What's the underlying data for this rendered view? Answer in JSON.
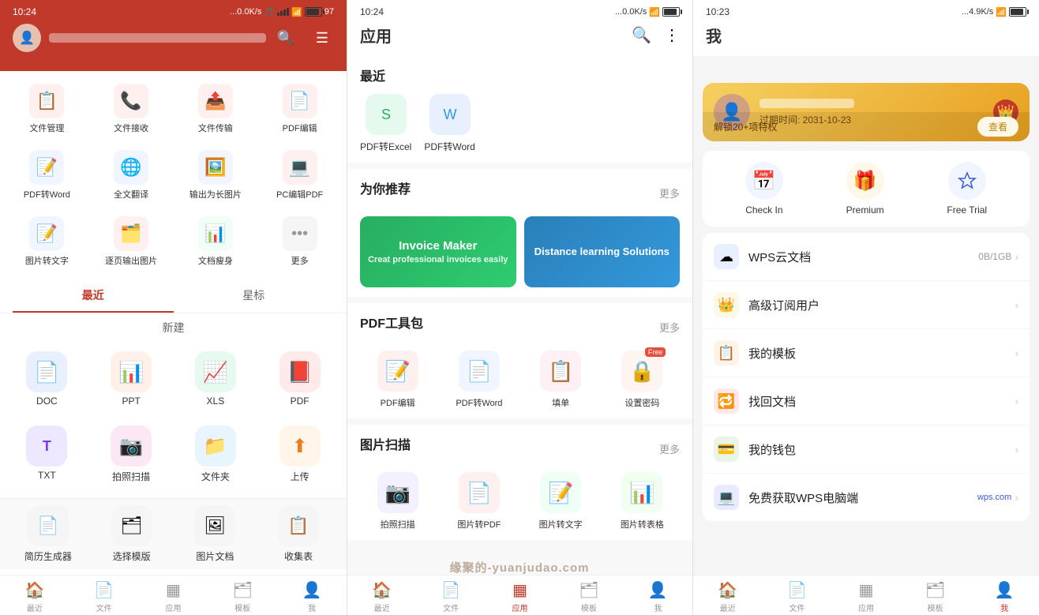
{
  "panel1": {
    "statusBar": {
      "time": "10:24",
      "network": "...0.0K/s",
      "battery": "97"
    },
    "topBar": {
      "searchIcon": "🔍",
      "menuIcon": "☰"
    },
    "tools": [
      {
        "label": "文件管理",
        "icon": "📋",
        "bg": "#fff0f0",
        "color": "#e74c3c"
      },
      {
        "label": "文件接收",
        "icon": "📞",
        "bg": "#fff0f0",
        "color": "#e74c3c"
      },
      {
        "label": "文件传输",
        "icon": "📤",
        "bg": "#fff0f0",
        "color": "#e74c3c"
      },
      {
        "label": "PDF编辑",
        "icon": "📄",
        "bg": "#fff0f0",
        "color": "#e74c3c"
      },
      {
        "label": "PDF转Word",
        "icon": "📝",
        "bg": "#f0f5ff",
        "color": "#3498db"
      },
      {
        "label": "全文翻译",
        "icon": "🌐",
        "bg": "#f0f5ff",
        "color": "#3498db"
      },
      {
        "label": "输出为长图片",
        "icon": "🖼️",
        "bg": "#f0f5ff",
        "color": "#3498db"
      },
      {
        "label": "PC编辑PDF",
        "icon": "💻",
        "bg": "#fff0f0",
        "color": "#e74c3c"
      },
      {
        "label": "图片转文字",
        "icon": "📝",
        "bg": "#f0f5ff",
        "color": "#3498db"
      },
      {
        "label": "逐页输出图片",
        "icon": "🗂️",
        "bg": "#fff0f0",
        "color": "#e74c3c"
      },
      {
        "label": "文档瘦身",
        "icon": "📊",
        "bg": "#f0fff5",
        "color": "#27ae60"
      },
      {
        "label": "更多",
        "icon": "⋯",
        "bg": "#f5f5f5",
        "color": "#999"
      }
    ],
    "tabs": [
      {
        "label": "最近",
        "active": true
      },
      {
        "label": "星标",
        "active": false
      }
    ],
    "newSection": "新建",
    "createItems": [
      {
        "label": "DOC",
        "icon": "📄",
        "bg": "#e8f0fe",
        "color": "#3b5bdb"
      },
      {
        "label": "PPT",
        "icon": "📊",
        "bg": "#fff0ea",
        "color": "#e74c3c"
      },
      {
        "label": "XLS",
        "icon": "📈",
        "bg": "#e6faf0",
        "color": "#27ae60"
      },
      {
        "label": "PDF",
        "icon": "📕",
        "bg": "#ffeaea",
        "color": "#e74c3c"
      }
    ],
    "extraItems": [
      {
        "label": "TXT",
        "icon": "T",
        "bg": "#ede8ff",
        "color": "#7c3aed"
      },
      {
        "label": "拍照扫描",
        "icon": "📷",
        "bg": "#fce8f5",
        "color": "#c0392b"
      },
      {
        "label": "文件夹",
        "icon": "📁",
        "bg": "#e8f5ff",
        "color": "#3498db"
      },
      {
        "label": "上传",
        "icon": "⬆",
        "bg": "#fff5e8",
        "color": "#e67e22"
      }
    ],
    "bottomBar": [
      {
        "label": "最近",
        "icon": "🏠",
        "active": false
      },
      {
        "label": "文件",
        "icon": "📄",
        "active": false
      },
      {
        "label": "应用",
        "icon": "▦",
        "active": false
      },
      {
        "label": "模板",
        "icon": "🗂",
        "active": false
      },
      {
        "label": "我",
        "icon": "👤",
        "active": false
      }
    ],
    "bottomTools": [
      {
        "label": "简历生成器",
        "icon": "📄"
      },
      {
        "label": "选择模版",
        "icon": "🗂"
      },
      {
        "label": "图片文档",
        "icon": "🖼"
      },
      {
        "label": "收集表",
        "icon": "📋"
      }
    ]
  },
  "panel2": {
    "statusBar": {
      "time": "10:24",
      "network": "...0.0K/s"
    },
    "title": "应用",
    "sections": {
      "recent": {
        "title": "最近",
        "items": [
          {
            "label": "PDF转Excel",
            "icon": "📊",
            "bg": "#e6f9ee"
          },
          {
            "label": "PDF转Word",
            "icon": "📝",
            "bg": "#e8f0fe"
          }
        ]
      },
      "recommended": {
        "title": "为你推荐",
        "more": "更多",
        "banners": [
          {
            "title": "Invoice Maker",
            "subtitle": "Creat professional invoices easily",
            "bg": "green"
          },
          {
            "title": "Distance learning Solutions",
            "bg": "blue"
          }
        ]
      },
      "pdfTools": {
        "title": "PDF工具包",
        "more": "更多",
        "items": [
          {
            "label": "PDF编辑",
            "icon": "📝",
            "bg": "#fff0f0",
            "free": false
          },
          {
            "label": "PDF转Word",
            "icon": "📄",
            "bg": "#f0f5ff",
            "free": false
          },
          {
            "label": "填单",
            "icon": "📋",
            "bg": "#fff0f5",
            "free": false
          },
          {
            "label": "设置密码",
            "icon": "🔒",
            "bg": "#fff5f0",
            "free": true
          }
        ]
      },
      "imageScan": {
        "title": "图片扫描",
        "more": "更多",
        "items": [
          {
            "label": "拍照扫描",
            "icon": "📷",
            "bg": "#f5f0ff"
          },
          {
            "label": "图片转PDF",
            "icon": "📄",
            "bg": "#fff0f0"
          },
          {
            "label": "图片转文字",
            "icon": "📝",
            "bg": "#f0fff0"
          },
          {
            "label": "图片转表格",
            "icon": "📊",
            "bg": "#e6f9f0"
          }
        ]
      }
    },
    "bottomBar": [
      {
        "label": "最近",
        "icon": "🏠",
        "active": false
      },
      {
        "label": "文件",
        "icon": "📄",
        "active": false
      },
      {
        "label": "应用",
        "icon": "▦",
        "active": true
      },
      {
        "label": "模板",
        "icon": "🗂",
        "active": false
      },
      {
        "label": "我",
        "icon": "👤",
        "active": false
      }
    ]
  },
  "panel3": {
    "statusBar": {
      "time": "10:23",
      "network": "...4.9K/s"
    },
    "title": "我",
    "vipCard": {
      "expiryLabel": "过期时间: 2031-10-23",
      "unlockText": "解锁20+项特权",
      "viewBtn": "查看"
    },
    "quickActions": [
      {
        "label": "Check In",
        "icon": "📅"
      },
      {
        "label": "Premium",
        "icon": "🎁"
      },
      {
        "label": "Free Trial",
        "icon": "◇"
      }
    ],
    "menuItems": [
      {
        "label": "WPS云文档",
        "icon": "☁",
        "iconBg": "#e8f0ff",
        "iconColor": "#3498db",
        "right": "0B/1GB"
      },
      {
        "label": "高级订阅用户",
        "icon": "👑",
        "iconBg": "#fff8e8",
        "iconColor": "#e8a020",
        "right": ""
      },
      {
        "label": "我的模板",
        "icon": "📋",
        "iconBg": "#fff3e8",
        "iconColor": "#e67e22",
        "right": ""
      },
      {
        "label": "找回文档",
        "icon": "🔁",
        "iconBg": "#ffe8e8",
        "iconColor": "#e74c3c",
        "right": ""
      },
      {
        "label": "我的钱包",
        "icon": "💳",
        "iconBg": "#e8f5e8",
        "iconColor": "#27ae60",
        "right": ""
      },
      {
        "label": "免费获取WPS电脑端",
        "icon": "💻",
        "iconBg": "#eaeaff",
        "iconColor": "#3b5bdb",
        "right": "wps.com"
      }
    ],
    "bottomBar": [
      {
        "label": "最近",
        "icon": "🏠",
        "active": false
      },
      {
        "label": "文件",
        "icon": "📄",
        "active": false
      },
      {
        "label": "应用",
        "icon": "▦",
        "active": false
      },
      {
        "label": "模板",
        "icon": "🗂",
        "active": false
      },
      {
        "label": "我",
        "icon": "👤",
        "active": true
      }
    ]
  },
  "watermark": "缘聚的-yuanjudao.com"
}
